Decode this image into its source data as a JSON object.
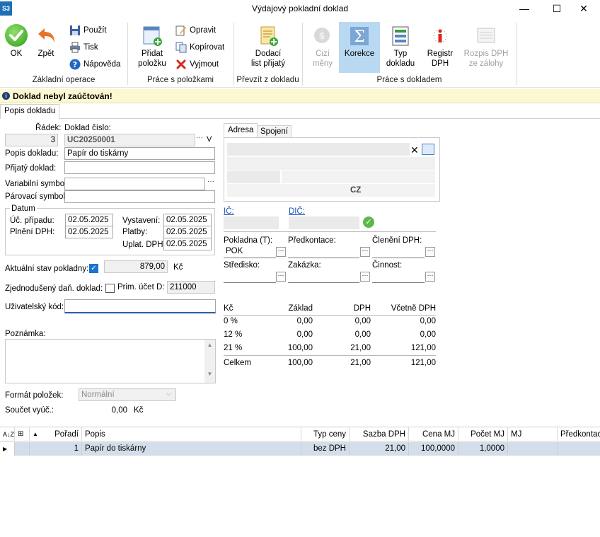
{
  "window": {
    "app_icon": "S3",
    "title": "Výdajový pokladní doklad",
    "minimize": "—",
    "maximize": "☐",
    "close": "✕"
  },
  "ribbon": {
    "groups": {
      "basic": "Základní operace",
      "items": "Práce s položkami",
      "take_over": "Převzít z dokladu",
      "document": "Práce s dokladem"
    },
    "ok": "OK",
    "back": "Zpět",
    "use": "Použít",
    "print": "Tisk",
    "help": "Nápověda",
    "add_item_1": "Přidat",
    "add_item_2": "položku",
    "edit": "Opravit",
    "copy": "Kopírovat",
    "cut": "Vyjmout",
    "delivery_1": "Dodací",
    "delivery_2": "list přijatý",
    "foreign_1": "Cizí",
    "foreign_2": "měny",
    "correction": "Korekce",
    "doc_type_1": "Typ",
    "doc_type_2": "dokladu",
    "registry_1": "Registr",
    "registry_2": "DPH",
    "vat_split_1": "Rozpis DPH",
    "vat_split_2": "ze zálohy"
  },
  "info_bar": {
    "icon": "info-icon",
    "text": "Doklad nebyl zaúčtován!"
  },
  "tabs": {
    "main": "Popis dokladu"
  },
  "form": {
    "row_label": "Řádek:",
    "row_value": "3",
    "doc_no_label": "Doklad číslo:",
    "doc_no_value": "UC20250001",
    "doc_no_dropdown": "V",
    "desc_label": "Popis dokladu:",
    "desc_value": "Papír do tiskárny",
    "received_label": "Přijatý doklad:",
    "received_value": "",
    "var_symbol_label": "Variabilní symbol:",
    "var_symbol_value": "",
    "pair_symbol_label": "Párovací symbol:",
    "pair_symbol_value": "",
    "date_group": "Datum",
    "uc_label": "Úč. případu:",
    "uc_value": "02.05.2025",
    "vat_fulfil_label": "Plnění DPH:",
    "vat_fulfil_value": "02.05.2025",
    "issued_label": "Vystavení:",
    "issued_value": "02.05.2025",
    "payment_label": "Platby:",
    "payment_value": "02.05.2025",
    "vat_apply_label": "Uplat. DPH:",
    "vat_apply_value": "02.05.2025",
    "cash_state_label": "Aktuální stav pokladny:",
    "cash_state_value": "879,00",
    "cash_state_currency": "Kč",
    "simplified_label": "Zjednodušený daň. doklad:",
    "prim_account_label": "Prim. účet D:",
    "prim_account_value": "211000",
    "user_code_label": "Uživatelský kód:",
    "user_code_value": "",
    "note_label": "Poznámka:",
    "note_value": "",
    "item_format_label": "Formát položek:",
    "item_format_value": "Normální",
    "rounding_sum_label": "Součet vyúč.:",
    "rounding_sum_value": "0,00",
    "rounding_sum_currency": "Kč"
  },
  "address": {
    "tab_address": "Adresa",
    "tab_contact": "Spojení",
    "country": "CZ",
    "ic_label": "IČ:",
    "dic_label": "DIČ:",
    "cashdesk_label": "Pokladna (T):",
    "cashdesk_value": "POK",
    "precontation_label": "Předkontace:",
    "precontation_value": "",
    "vat_class_label": "Členění DPH:",
    "vat_class_value": "",
    "center_label": "Středisko:",
    "center_value": "",
    "order_label": "Zakázka:",
    "order_value": "",
    "activity_label": "Činnost:",
    "activity_value": ""
  },
  "vat_table": {
    "headers": [
      "Kč",
      "Základ",
      "DPH",
      "Včetně DPH"
    ],
    "rows": [
      [
        "0 %",
        "0,00",
        "0,00",
        "0,00"
      ],
      [
        "12 %",
        "0,00",
        "0,00",
        "0,00"
      ],
      [
        "21 %",
        "100,00",
        "21,00",
        "121,00"
      ],
      [
        "Celkem",
        "100,00",
        "21,00",
        "121,00"
      ]
    ]
  },
  "grid": {
    "headers": [
      "Pořadí",
      "Popis",
      "Typ ceny",
      "Sazba DPH",
      "Cena MJ",
      "Počet MJ",
      "MJ",
      "Předkontace"
    ],
    "rows": [
      [
        "1",
        "Papír do tiskárny",
        "bez DPH",
        "21,00",
        "100,0000",
        "1,0000",
        "",
        ""
      ]
    ]
  }
}
